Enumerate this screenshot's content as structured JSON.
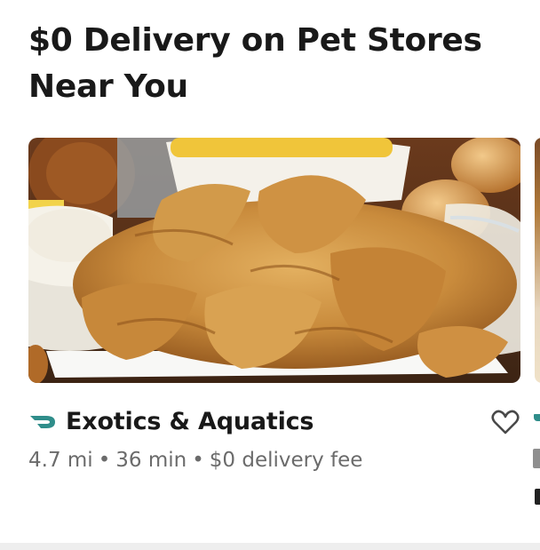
{
  "section": {
    "title": "$0 Delivery on Pet Stores Near You"
  },
  "store_card": {
    "image_icon": "food-photo-fried-chicken-tenders",
    "name": "Exotics & Aquatics",
    "badge_icon": "dashpass-icon",
    "favorite_icon": "heart-outline-icon",
    "distance": "4.7 mi",
    "separator": "•",
    "eta": "36 min",
    "delivery_fee": "$0 delivery fee"
  },
  "colors": {
    "accent": "#2f8d8a",
    "text_primary": "#191919",
    "text_secondary": "#6b6b6b",
    "divider": "#eeeeee"
  }
}
